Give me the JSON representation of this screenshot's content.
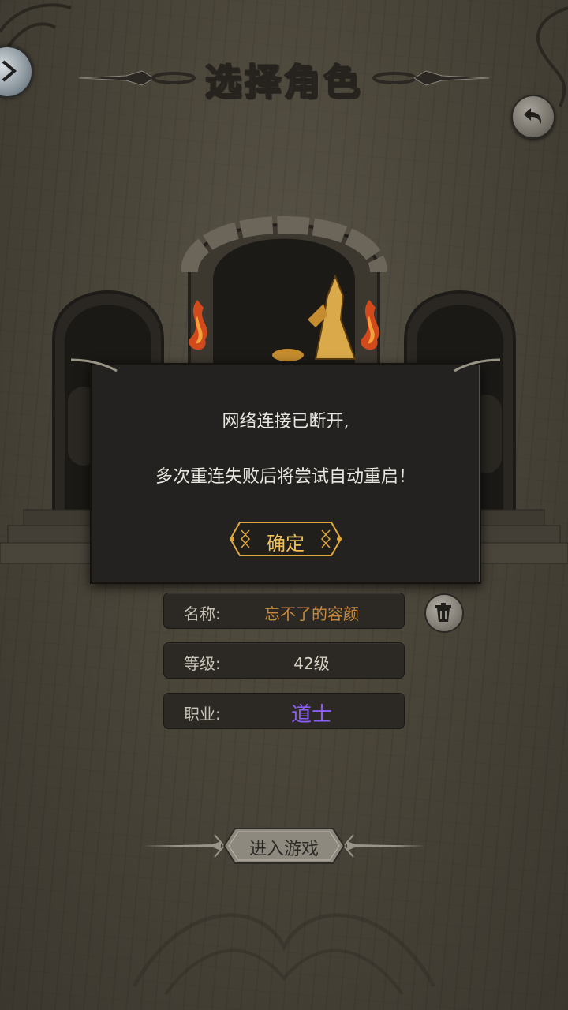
{
  "header": {
    "title": "选择角色"
  },
  "dialog": {
    "line1": "网络连接已断开,",
    "line2": "多次重连失败后将尝试自动重启！",
    "confirm_label": "确定"
  },
  "character": {
    "name_label": "名称:",
    "name_value": "忘不了的容颜",
    "level_label": "等级:",
    "level_value": "42级",
    "class_label": "职业:",
    "class_value": "道士"
  },
  "enter_game_label": "进入游戏",
  "colors": {
    "name_value": "#c98a3a",
    "level_value": "#d6d1c4",
    "class_value": "#8b5cf6",
    "confirm_accent": "#f0c055"
  },
  "icons": [
    "back-arrow-icon",
    "return-arrow-icon",
    "trash-icon",
    "torch-flame-icon"
  ]
}
